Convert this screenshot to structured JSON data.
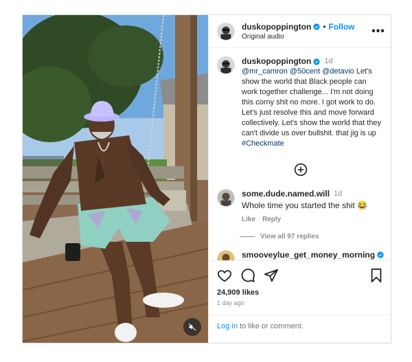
{
  "header": {
    "username": "duskopoppington",
    "follow_label": "Follow",
    "subtitle": "Original audio",
    "separator": "•",
    "more_label": "•••"
  },
  "caption": {
    "username": "duskopoppington",
    "time": "1d",
    "mentions": [
      "@mr_camron",
      "@50cent",
      "@detavio"
    ],
    "text": " Let's show the world that Black people can work together challenge... I'm not doing this corny shit no more. I got work to do. Let's just resolve this and move forward collectively. Let's show the world that they can't divide us over bullshit. that jig is up ",
    "hashtag": "#Checkmate"
  },
  "comments": [
    {
      "username": "some.dude.named.will",
      "time": "1d",
      "text": "Whole time you started the shit 😂",
      "like_label": "Like",
      "reply_label": "Reply",
      "view_replies_label": "View all 97 replies"
    },
    {
      "username": "smooveylue_get_money_morning"
    }
  ],
  "actions": {
    "likes": "24,909 likes",
    "ago": "1 day ago"
  },
  "login_bar": {
    "login_label": "Log in",
    "rest_text": " to like or comment."
  },
  "colors": {
    "accent": "#0095f6",
    "verified": "#0095f6",
    "link": "#00376b",
    "muted": "#8e8e8e"
  },
  "icons": {
    "verified": "verified-badge-icon",
    "add_comment": "plus-circle-icon",
    "like": "heart-icon",
    "comment": "comment-bubble-icon",
    "share": "paper-plane-icon",
    "save": "bookmark-icon",
    "mute": "speaker-muted-icon",
    "more": "more-options-icon"
  }
}
